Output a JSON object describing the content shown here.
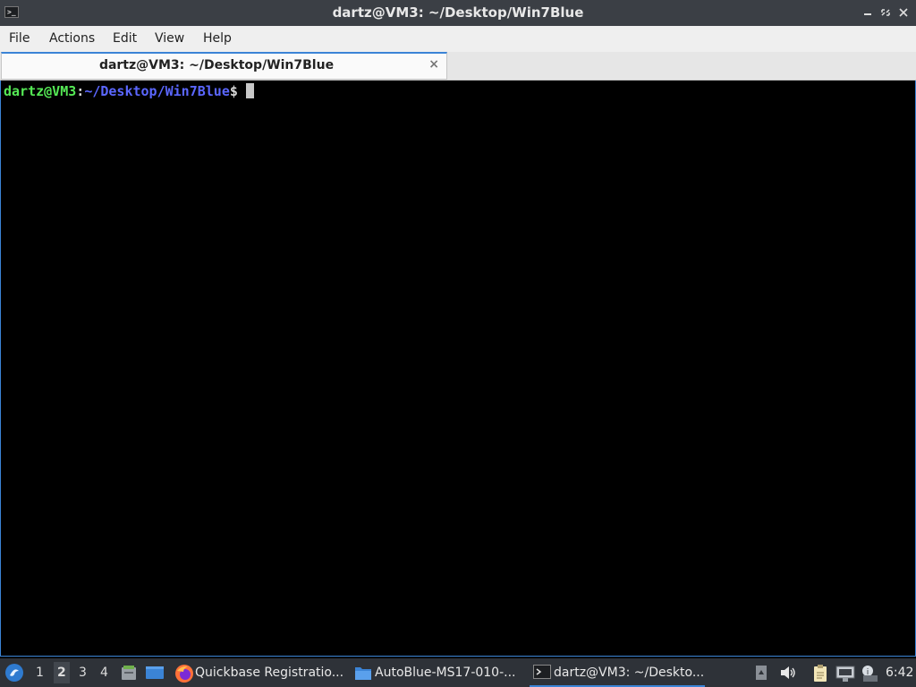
{
  "window": {
    "title": "dartz@VM3: ~/Desktop/Win7Blue",
    "icon": "terminal-icon",
    "controls": [
      "minimize",
      "maximize",
      "close"
    ]
  },
  "menu": {
    "file": "File",
    "actions": "Actions",
    "edit": "Edit",
    "view": "View",
    "help": "Help"
  },
  "tab": {
    "label": "dartz@VM3: ~/Desktop/Win7Blue",
    "close": "×"
  },
  "terminal": {
    "user_host": "dartz@VM3",
    "separator": ":",
    "path": "~/Desktop/Win7Blue",
    "dollar": "$",
    "colors": {
      "user": "#55e955",
      "path": "#5b67ff",
      "background": "#000000"
    }
  },
  "taskbar": {
    "workspaces": [
      "1",
      "2",
      "3",
      "4"
    ],
    "active_workspace": "2",
    "tasks": [
      {
        "label": "Quickbase Registratio...",
        "icon": "firefox-icon"
      },
      {
        "label": "AutoBlue-MS17-010-...",
        "icon": "folder-icon"
      },
      {
        "label": "dartz@VM3: ~/Deskto...",
        "icon": "terminal-icon"
      }
    ],
    "clock": "6:42",
    "accent": "#3b84d6"
  }
}
